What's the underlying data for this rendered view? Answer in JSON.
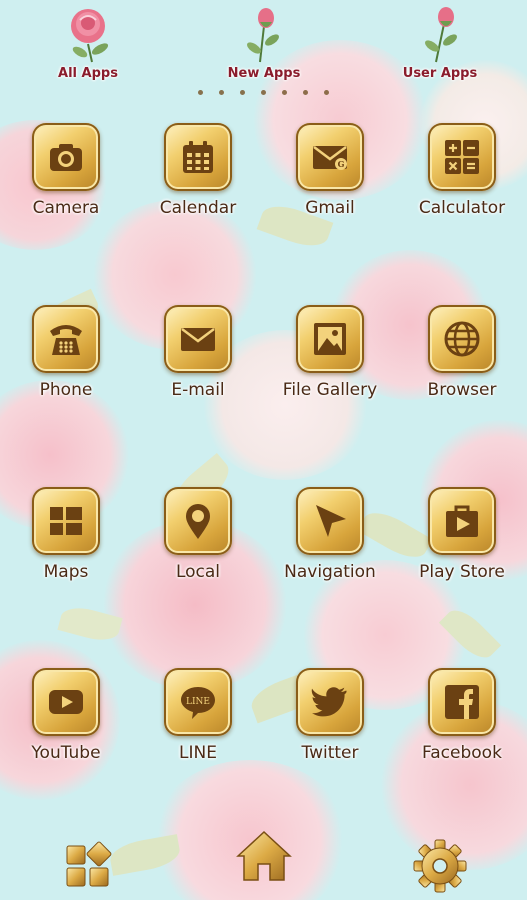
{
  "tabs": [
    {
      "label": "All Apps"
    },
    {
      "label": "New Apps"
    },
    {
      "label": "User Apps"
    }
  ],
  "page_indicator": {
    "count": 7
  },
  "apps": [
    {
      "label": "Camera",
      "icon": "camera-icon"
    },
    {
      "label": "Calendar",
      "icon": "calendar-icon"
    },
    {
      "label": "Gmail",
      "icon": "gmail-icon"
    },
    {
      "label": "Calculator",
      "icon": "calculator-icon"
    },
    {
      "label": "Phone",
      "icon": "phone-icon"
    },
    {
      "label": "E-mail",
      "icon": "email-icon"
    },
    {
      "label": "File Gallery",
      "icon": "gallery-icon"
    },
    {
      "label": "Browser",
      "icon": "globe-icon"
    },
    {
      "label": "Maps",
      "icon": "maps-icon"
    },
    {
      "label": "Local",
      "icon": "location-pin-icon"
    },
    {
      "label": "Navigation",
      "icon": "navigation-arrow-icon"
    },
    {
      "label": "Play Store",
      "icon": "play-store-icon"
    },
    {
      "label": "YouTube",
      "icon": "youtube-icon"
    },
    {
      "label": "LINE",
      "icon": "line-icon"
    },
    {
      "label": "Twitter",
      "icon": "twitter-bird-icon"
    },
    {
      "label": "Facebook",
      "icon": "facebook-icon"
    }
  ],
  "line_badge_text": "LINE",
  "dock": [
    {
      "icon": "app-drawer-icon"
    },
    {
      "icon": "home-icon"
    },
    {
      "icon": "settings-gear-icon"
    }
  ],
  "colors": {
    "gold_dark": "#6b4112",
    "label": "#4a2a16",
    "tab_label": "#8a1c2c",
    "background": "#cfeff0"
  }
}
